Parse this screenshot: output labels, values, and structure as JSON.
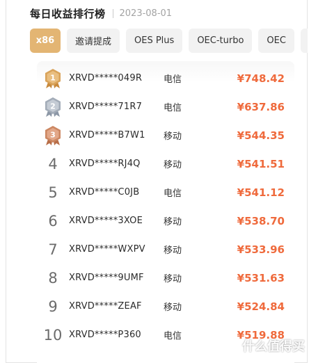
{
  "header": {
    "title": "每日收益排行榜",
    "date": "2023-08-01"
  },
  "tabs": [
    {
      "label": "x86",
      "active": true
    },
    {
      "label": "邀请提成",
      "active": false
    },
    {
      "label": "OES Plus",
      "active": false
    },
    {
      "label": "OEC-turbo",
      "active": false
    },
    {
      "label": "OEC",
      "active": false
    }
  ],
  "ranking": [
    {
      "rank": "1",
      "user": "XRVD*****049R",
      "carrier": "电信",
      "amount": "¥748.42"
    },
    {
      "rank": "2",
      "user": "XRVD*****71R7",
      "carrier": "电信",
      "amount": "¥637.86"
    },
    {
      "rank": "3",
      "user": "XRVD*****B7W1",
      "carrier": "移动",
      "amount": "¥544.35"
    },
    {
      "rank": "4",
      "user": "XRVD*****RJ4Q",
      "carrier": "移动",
      "amount": "¥541.51"
    },
    {
      "rank": "5",
      "user": "XRVD*****C0JB",
      "carrier": "电信",
      "amount": "¥541.12"
    },
    {
      "rank": "6",
      "user": "XRVD*****3XOE",
      "carrier": "移动",
      "amount": "¥538.70"
    },
    {
      "rank": "7",
      "user": "XRVD*****WXPV",
      "carrier": "移动",
      "amount": "¥533.96"
    },
    {
      "rank": "8",
      "user": "XRVD*****9UMF",
      "carrier": "移动",
      "amount": "¥531.63"
    },
    {
      "rank": "9",
      "user": "XRVD*****ZEAF",
      "carrier": "移动",
      "amount": "¥524.84"
    },
    {
      "rank": "10",
      "user": "XRVD*****P360",
      "carrier": "电信",
      "amount": "¥519.88"
    }
  ],
  "colors": {
    "accent_tab": "#e3b573",
    "amount": "#ef6a3c",
    "gold": "#d49a4a",
    "silver": "#9aa3b0",
    "bronze": "#c8815a"
  },
  "icons": {
    "medal_gold": "medal-gold-icon",
    "medal_silver": "medal-silver-icon",
    "medal_bronze": "medal-bronze-icon"
  },
  "watermark": {
    "text": "什么值得买"
  }
}
